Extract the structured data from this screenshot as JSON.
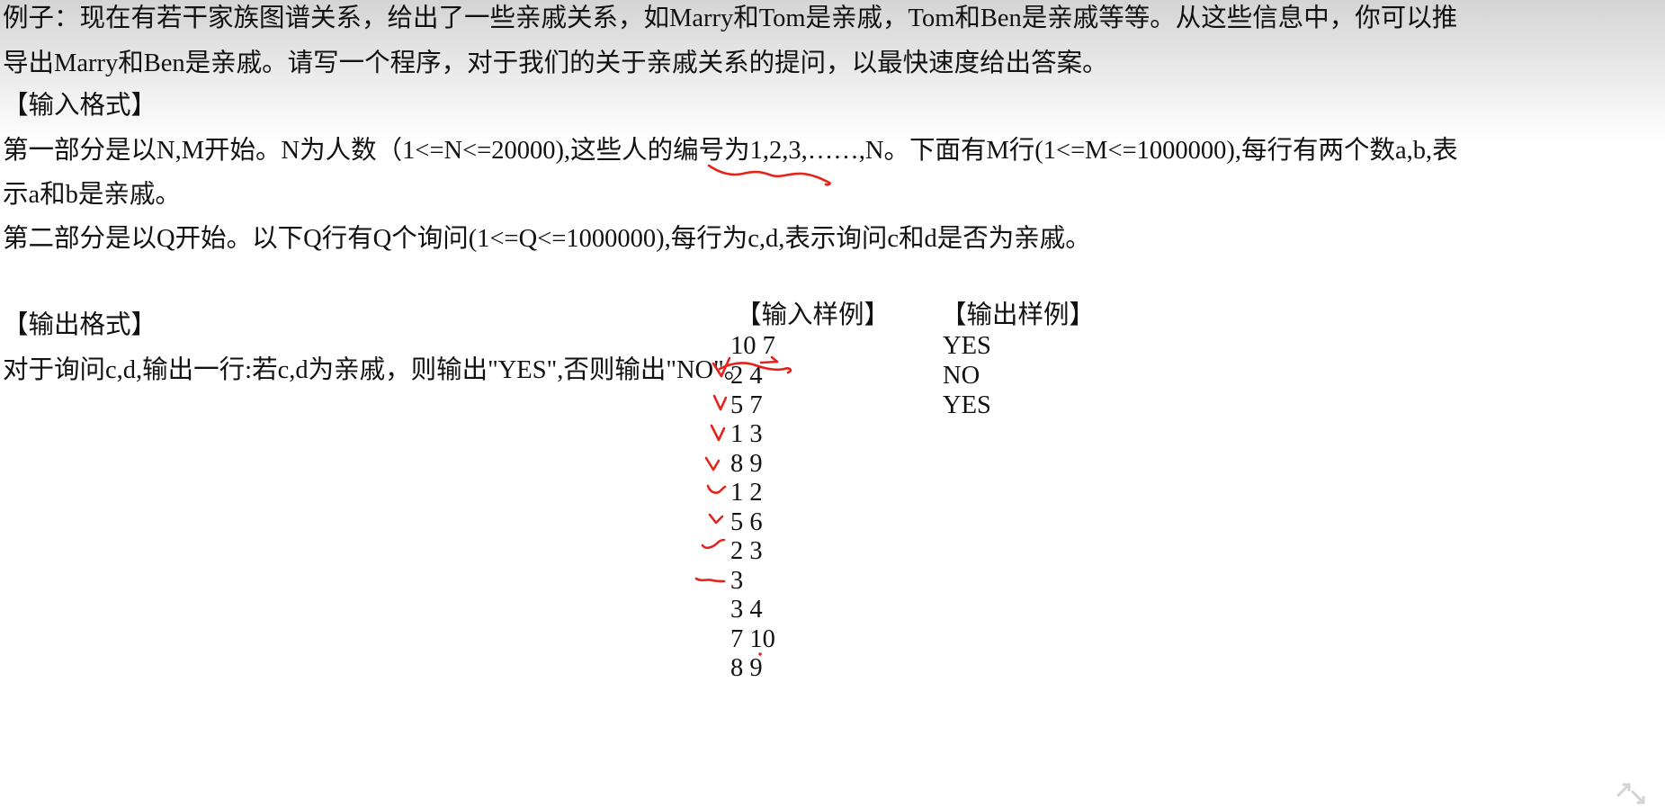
{
  "intro": {
    "line1": "例子：现在有若干家族图谱关系，给出了一些亲戚关系，如Marry和Tom是亲戚，Tom和Ben是亲戚等等。从这些信息中，你可以推",
    "line2": "导出Marry和Ben是亲戚。请写一个程序，对于我们的关于亲戚关系的提问，以最快速度给出答案。"
  },
  "input_format": {
    "heading": "【输入格式】",
    "part1_line1": "第一部分是以N,M开始。N为人数（1<=N<=20000),这些人的编号为1,2,3,……,N。下面有M行(1<=M<=1000000),每行有两个数a,b,表",
    "part1_line2": "示a和b是亲戚。",
    "part2": "第二部分是以Q开始。以下Q行有Q个询问(1<=Q<=1000000),每行为c,d,表示询问c和d是否为亲戚。"
  },
  "output_format": {
    "heading": "【输出格式】",
    "text": "对于询问c,d,输出一行:若c,d为亲戚，则输出\"YES\",否则输出\"NO\"。"
  },
  "input_sample": {
    "heading": "【输入样例】",
    "lines": [
      "10 7",
      "2 4",
      "5 7",
      "1 3",
      "8 9",
      "1 2",
      "5 6",
      "2 3",
      "3",
      "3 4",
      "7 10",
      "8 9"
    ]
  },
  "output_sample": {
    "heading": "【输出样例】",
    "lines": [
      "YES",
      "NO",
      "YES"
    ]
  },
  "colors": {
    "text": "#111111",
    "annotation_red": "#e5231b"
  },
  "icons": {
    "corner": "fullscreen-toggle-icon"
  }
}
